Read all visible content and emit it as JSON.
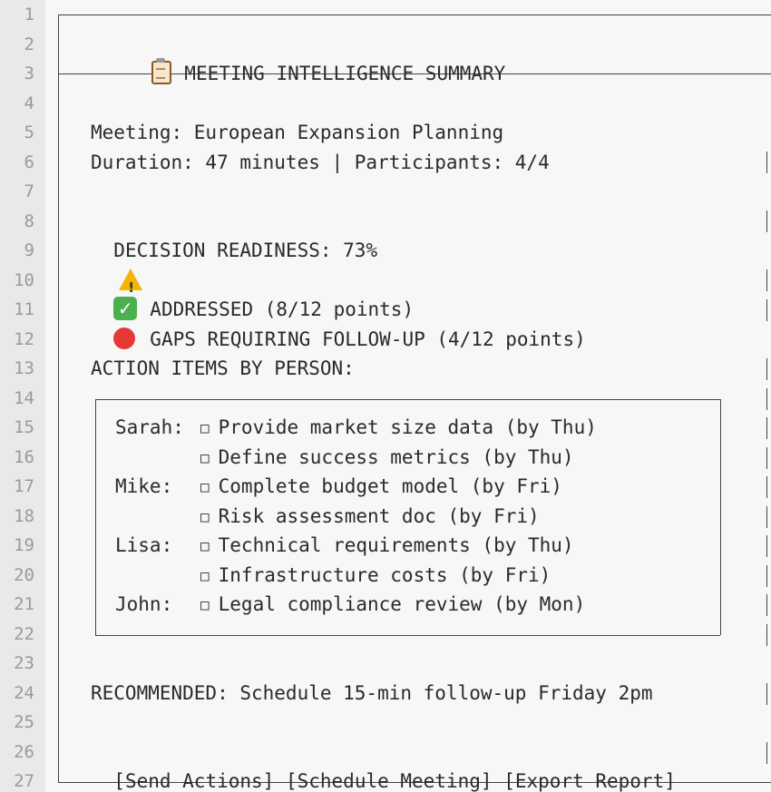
{
  "gutter": {
    "line_numbers": [
      "1",
      "2",
      "3",
      "4",
      "5",
      "6",
      "7",
      "8",
      "9",
      "10",
      "11",
      "12",
      "13",
      "14",
      "15",
      "16",
      "17",
      "18",
      "19",
      "20",
      "21",
      "22",
      "23",
      "24",
      "25",
      "26",
      "27"
    ]
  },
  "header": {
    "title_icon": "clipboard-icon",
    "title": "MEETING INTELLIGENCE SUMMARY"
  },
  "meeting": {
    "name_line": "Meeting: European Expansion Planning",
    "duration_line": "Duration: 47 minutes | Participants: 4/4"
  },
  "readiness": {
    "label": "DECISION READINESS: 73%",
    "value_percent": 73,
    "icon": "warning-icon"
  },
  "status": {
    "addressed": "ADDRESSED (8/12 points)",
    "addressed_icon": "check-icon",
    "gaps": "GAPS REQUIRING FOLLOW-UP (4/12 points)",
    "gaps_icon": "red-circle-icon"
  },
  "actions": {
    "heading": "ACTION ITEMS BY PERSON:",
    "rows": [
      {
        "person": "Sarah:",
        "item": "Provide market size data (by Thu)"
      },
      {
        "person": "",
        "item": "Define success metrics (by Thu)"
      },
      {
        "person": "Mike:",
        "item": "Complete budget model (by Fri)"
      },
      {
        "person": "",
        "item": "Risk assessment doc (by Fri)"
      },
      {
        "person": "Lisa:",
        "item": "Technical requirements (by Thu)"
      },
      {
        "person": "",
        "item": "Infrastructure costs (by Fri)"
      },
      {
        "person": "John:",
        "item": "Legal compliance review (by Mon)"
      }
    ],
    "checkbox_glyph": "□"
  },
  "recommendation": "RECOMMENDED: Schedule 15-min follow-up Friday 2pm",
  "buttons": {
    "send": "[Send Actions]",
    "schedule": "[Schedule Meeting]",
    "export": "[Export Report]"
  },
  "colors": {
    "background": "#f7f7f7",
    "gutter": "#e9e9e9",
    "text": "#2a2a2a",
    "check": "#4caf50",
    "red": "#e53935",
    "warning": "#f4b400"
  }
}
